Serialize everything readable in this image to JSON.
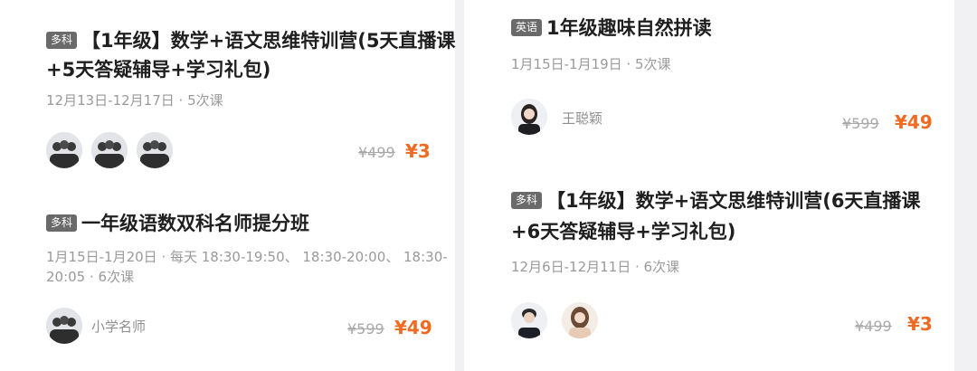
{
  "colors": {
    "accent": "#ef6a22",
    "badge": "#6a6a6a",
    "muted": "#9a9a9a"
  },
  "left": {
    "card1": {
      "badge": "多科",
      "title_line1": "【1年级】数学+语文思维特训营(5天直播课",
      "title_line2": "+5天答疑辅导+学习礼包)",
      "meta": "12月13日-12月17日 · 5次课",
      "original_price": "¥499",
      "price": "¥3"
    },
    "card2": {
      "badge": "多科",
      "title": "一年级语数双科名师提分班",
      "meta_line1": "1月15日-1月20日 · 每天 18:30-19:50、 18:30-20:00、 18:30-",
      "meta_line2": "20:05 · 6次课",
      "teacher": "小学名师",
      "original_price": "¥599",
      "price": "¥49"
    }
  },
  "right": {
    "card1": {
      "badge": "英语",
      "title": "1年级趣味自然拼读",
      "meta": "1月15日-1月19日 · 5次课",
      "teacher": "王聪颖",
      "original_price": "¥599",
      "price": "¥49"
    },
    "card2": {
      "badge": "多科",
      "title_line1": "【1年级】数学+语文思维特训营(6天直播课",
      "title_line2": "+6天答疑辅导+学习礼包)",
      "meta": "12月6日-12月11日 · 6次课",
      "original_price": "¥499",
      "price": "¥3"
    }
  }
}
